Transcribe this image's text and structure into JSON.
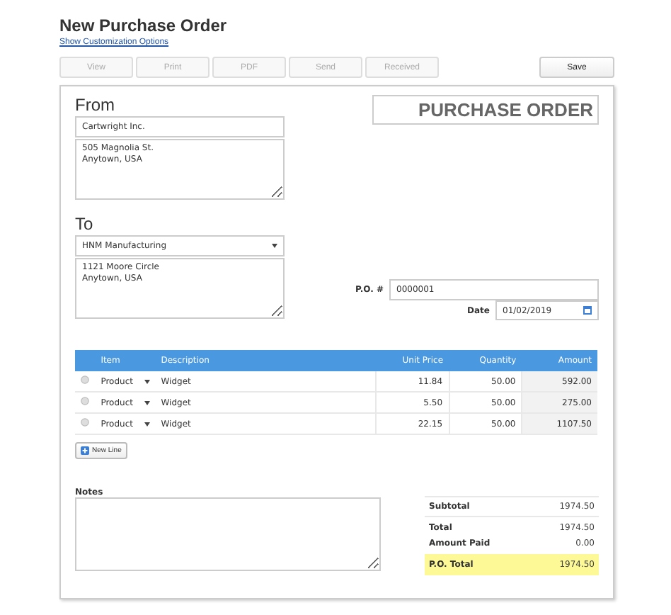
{
  "title": "New Purchase Order",
  "customize_link": "Show Customization Options",
  "toolbar": [
    {
      "label": "View",
      "disabled": true
    },
    {
      "label": "Print",
      "disabled": true
    },
    {
      "label": "PDF",
      "disabled": true
    },
    {
      "label": "Send",
      "disabled": true
    },
    {
      "label": "Received",
      "disabled": true
    }
  ],
  "save_button": "Save",
  "from": {
    "label": "From",
    "name": "Cartwright Inc.",
    "address": "505 Magnolia St.\nAnytown, USA"
  },
  "to": {
    "label": "To",
    "name": "HNM Manufacturing",
    "address": "1121 Moore Circle\nAnytown, USA"
  },
  "document_title": "PURCHASE ORDER",
  "meta": [
    {
      "label": "P.O. #",
      "value": "0000001",
      "kind": "text"
    },
    {
      "label": "Date",
      "value": "01/02/2019",
      "kind": "date"
    }
  ],
  "table": {
    "columns": [
      "Item",
      "Description",
      "Unit Price",
      "Quantity",
      "Amount"
    ],
    "rows": [
      {
        "item": "Product",
        "description": "Widget",
        "unit_price": "11.84",
        "quantity": "50.00",
        "amount": "592.00"
      },
      {
        "item": "Product",
        "description": "Widget",
        "unit_price": "5.50",
        "quantity": "50.00",
        "amount": "275.00"
      },
      {
        "item": "Product",
        "description": "Widget",
        "unit_price": "22.15",
        "quantity": "50.00",
        "amount": "1107.50"
      }
    ]
  },
  "new_line_button": "New Line",
  "notes": {
    "label": "Notes"
  },
  "totals": [
    {
      "label": "Subtotal",
      "value": "1974.50",
      "highlighted": false
    },
    {
      "label": "Total",
      "value": "1974.50",
      "highlighted": false
    },
    {
      "label": "Amount Paid",
      "value": "0.00",
      "highlighted": false
    },
    {
      "label": "P.O. Total",
      "value": "1974.50",
      "highlighted": true
    }
  ]
}
